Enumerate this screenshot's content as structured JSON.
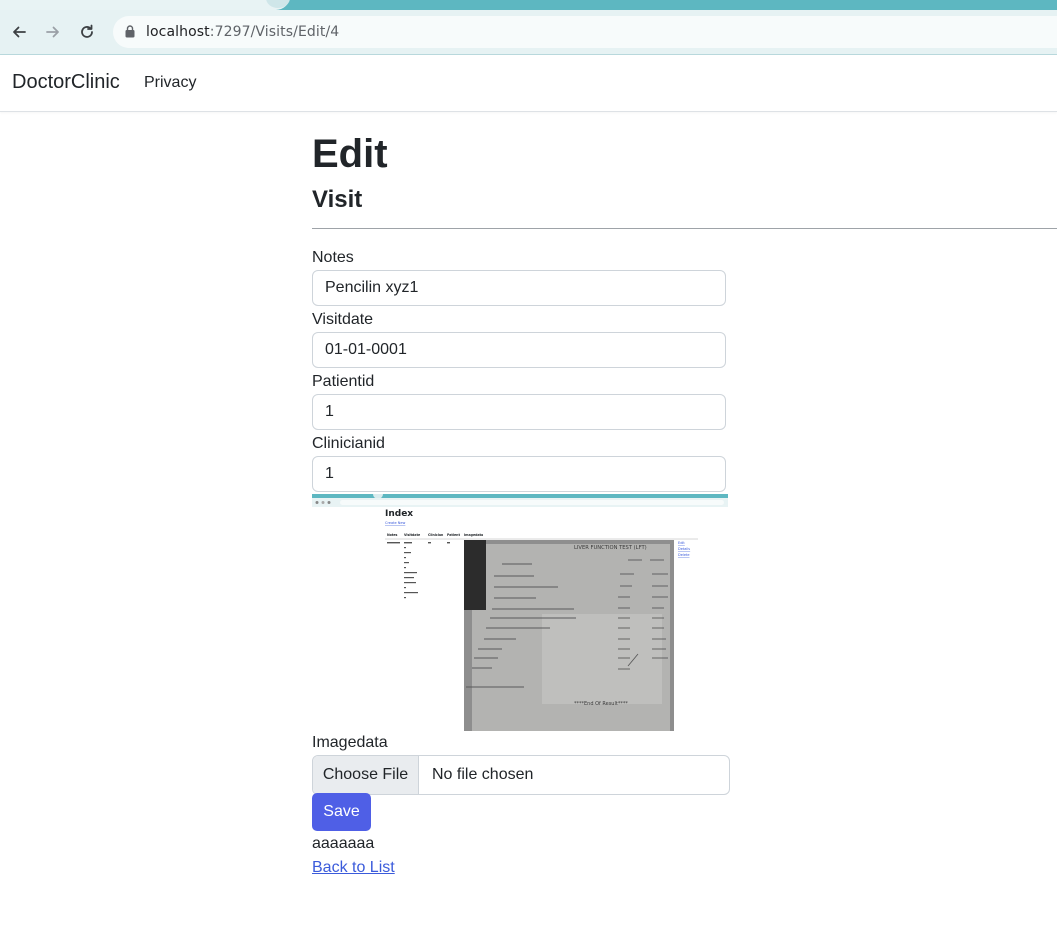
{
  "browser": {
    "url_host": "localhost",
    "url_path": ":7297/Visits/Edit/4"
  },
  "navbar": {
    "brand": "DoctorClinic",
    "links": [
      "Privacy"
    ]
  },
  "page": {
    "title": "Edit",
    "subtitle": "Visit"
  },
  "form": {
    "notes": {
      "label": "Notes",
      "value": "Pencilin xyz1"
    },
    "visitdate": {
      "label": "Visitdate",
      "value": "01-01-0001"
    },
    "patientid": {
      "label": "Patientid",
      "value": "1"
    },
    "clinicianid": {
      "label": "Clinicianid",
      "value": "1"
    },
    "imagedata": {
      "label": "Imagedata",
      "button": "Choose File",
      "status": "No file chosen"
    },
    "save_label": "Save",
    "note_text": "aaaaaaa",
    "back_link": "Back to List"
  },
  "preview": {
    "heading": "Index",
    "create_link": "Create New",
    "columns": [
      "Notes",
      "Visitdate",
      "Clinician",
      "Patient",
      "Imagedata"
    ],
    "report_title": "LIVER FUNCTION TEST (LFT)",
    "report_footer": "****End Of Result****",
    "row_links": [
      "Edit",
      "Details",
      "Delete"
    ]
  },
  "colors": {
    "primary": "#4f5fe6",
    "link": "#3b5bdb",
    "chrome_accent": "#5db7c1",
    "chrome_bar": "#e6f2f3"
  }
}
